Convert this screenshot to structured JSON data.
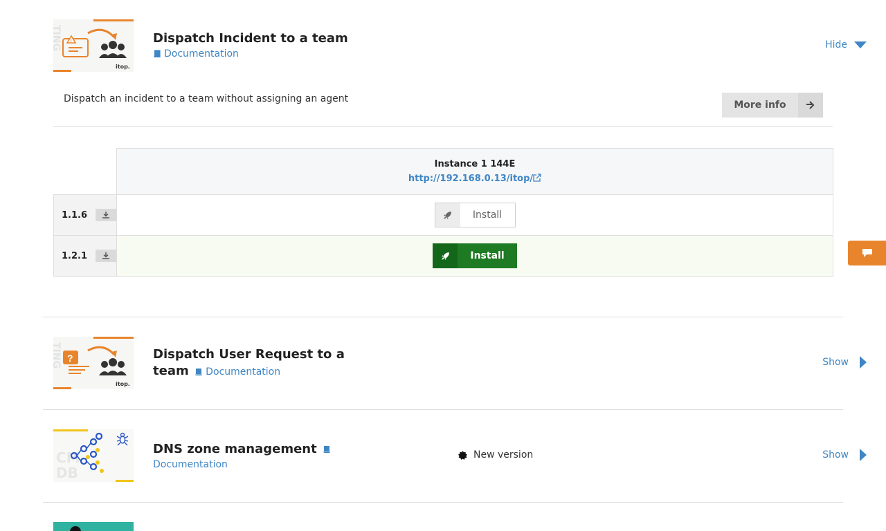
{
  "extensions": [
    {
      "title": "Dispatch Incident to a team",
      "doc_label": "Documentation",
      "toggle_label": "Hide",
      "description": "Dispatch an incident to a team without assigning an agent",
      "more_info_label": "More info",
      "thumb_icon": "incident-warning-icon",
      "thumb_brand": "itop.",
      "thumb_watermark": "TING",
      "instance": {
        "name": "Instance 1 144E",
        "url": "http://192.168.0.13/itop/"
      },
      "versions": [
        {
          "version": "1.1.6",
          "action_label": "Install",
          "style": "default"
        },
        {
          "version": "1.2.1",
          "action_label": "Install",
          "style": "primary"
        }
      ]
    },
    {
      "title_line1": "Dispatch User Request to a",
      "title_line2": "team",
      "doc_label": "Documentation",
      "toggle_label": "Show",
      "thumb_icon": "user-request-question-icon",
      "thumb_brand": "itop.",
      "thumb_watermark": "TING"
    },
    {
      "title": "DNS zone management",
      "doc_label": "Documentation",
      "toggle_label": "Show",
      "badge_label": "New version",
      "thumb_icon": "dns-network-icon",
      "thumb_watermark": "CMDB"
    }
  ],
  "colors": {
    "accent_orange": "#e8852c",
    "link_blue": "#3f86c4",
    "install_green": "#1e7a23"
  }
}
